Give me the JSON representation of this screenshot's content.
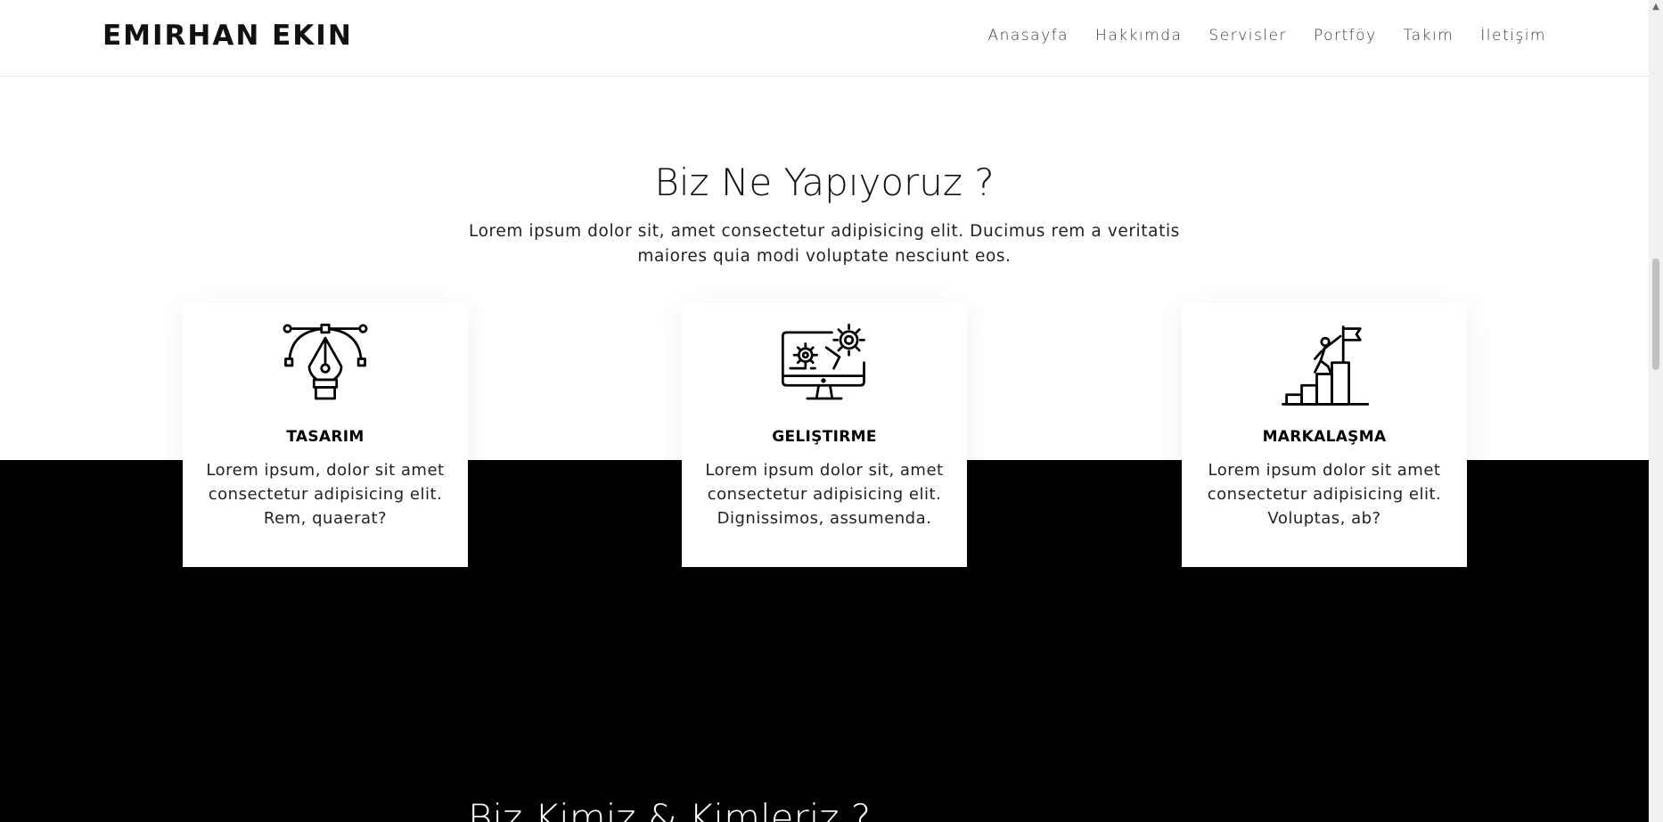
{
  "header": {
    "brand": "EMIRHAN EKIN",
    "nav": [
      "Anasayfa",
      "Hakkımda",
      "Servisler",
      "Portföy",
      "Takım",
      "İletişim"
    ]
  },
  "services": {
    "title": "Biz Ne Yapıyoruz ?",
    "lead": "Lorem ipsum dolor sit, amet consectetur adipisicing elit. Ducimus rem a veritatis maiores quia modi voluptate nesciunt eos.",
    "cards": [
      {
        "icon": "pen-tool-icon",
        "title": "TASARIM",
        "text": "Lorem ipsum, dolor sit amet consectetur adipisicing elit. Rem, quaerat?"
      },
      {
        "icon": "computer-gears-icon",
        "title": "GELIŞTIRME",
        "text": "Lorem ipsum dolor sit, amet consectetur adipisicing elit. Dignissimos, assumenda."
      },
      {
        "icon": "climber-flag-icon",
        "title": "MARKALAŞMA",
        "text": "Lorem ipsum dolor sit amet consectetur adipisicing elit. Voluptas, ab?"
      }
    ]
  },
  "about": {
    "title": "Biz Kimiz & Kimleriz ?"
  },
  "colors": {
    "band": "#000000",
    "card": "#ffffff",
    "text": "#111111"
  }
}
